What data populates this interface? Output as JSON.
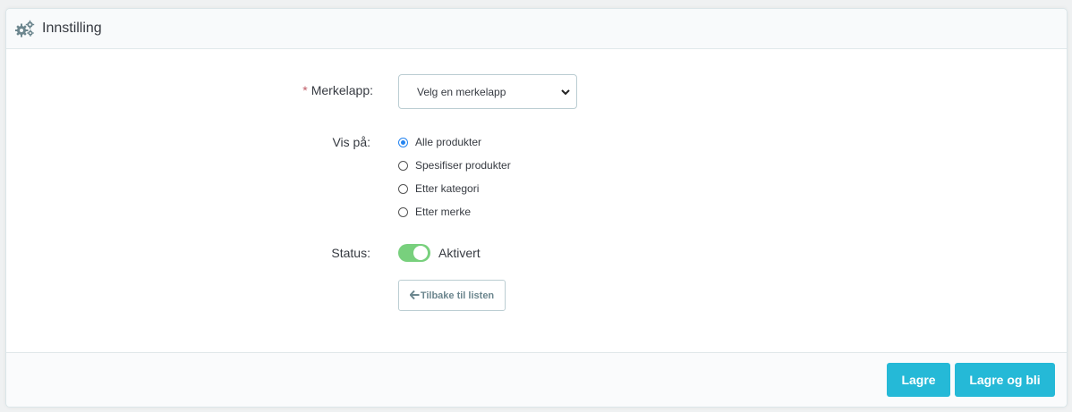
{
  "panel": {
    "title": "Innstilling",
    "icon": "gears-icon"
  },
  "form": {
    "label_field": {
      "required_mark": "*",
      "label": "Merkelapp:",
      "selected": "Velg en merkelapp"
    },
    "show_on": {
      "label": "Vis på:",
      "options": [
        {
          "label": "Alle produkter",
          "checked": true
        },
        {
          "label": "Spesifiser produkter",
          "checked": false
        },
        {
          "label": "Etter kategori",
          "checked": false
        },
        {
          "label": "Etter merke",
          "checked": false
        }
      ]
    },
    "status": {
      "label": "Status:",
      "value_label": "Aktivert",
      "enabled": true,
      "color": "#78d07d"
    },
    "back_button": {
      "label": "Tilbake til listen",
      "icon": "arrow-left-icon"
    }
  },
  "footer": {
    "save_label": "Lagre",
    "save_stay_label": "Lagre og bli",
    "accent": "#25b9d7"
  }
}
